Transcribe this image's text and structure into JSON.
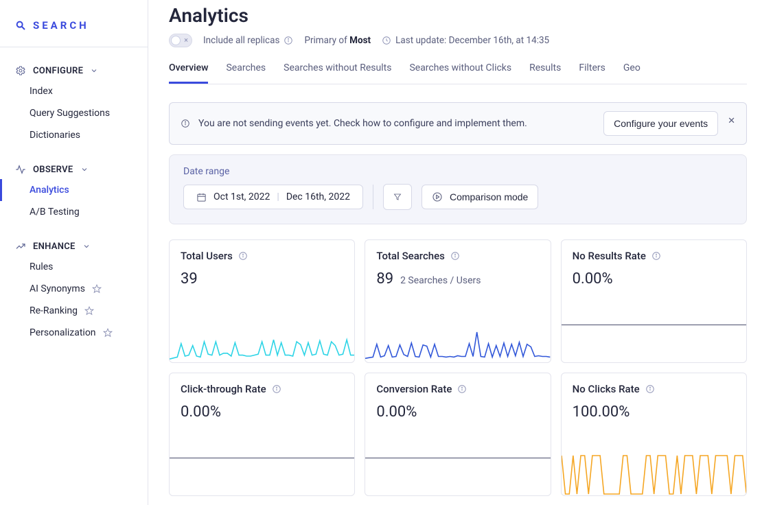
{
  "brand": {
    "label": "SEARCH"
  },
  "sidebar": {
    "configure": {
      "label": "CONFIGURE",
      "items": [
        {
          "label": "Index"
        },
        {
          "label": "Query Suggestions"
        },
        {
          "label": "Dictionaries"
        }
      ]
    },
    "observe": {
      "label": "OBSERVE",
      "items": [
        {
          "label": "Analytics"
        },
        {
          "label": "A/B Testing"
        }
      ]
    },
    "enhance": {
      "label": "ENHANCE",
      "items": [
        {
          "label": "Rules"
        },
        {
          "label": "AI Synonyms"
        },
        {
          "label": "Re-Ranking"
        },
        {
          "label": "Personalization"
        }
      ]
    }
  },
  "header": {
    "title": "Analytics",
    "includeReplicas": "Include all replicas",
    "primaryPrefix": "Primary of ",
    "primaryIndex": "Most",
    "lastUpdate": "Last update: December 16th, at 14:35"
  },
  "tabs": [
    "Overview",
    "Searches",
    "Searches without Results",
    "Searches without Clicks",
    "Results",
    "Filters",
    "Geo"
  ],
  "banner": {
    "message": "You are not sending events yet. Check how to configure and implement them.",
    "cta": "Configure your events"
  },
  "filters": {
    "label": "Date range",
    "from": "Oct 1st, 2022",
    "to": "Dec 16th, 2022",
    "comparison": "Comparison mode"
  },
  "cards": {
    "totalUsers": {
      "title": "Total Users",
      "value": "39"
    },
    "totalSearches": {
      "title": "Total Searches",
      "value": "89",
      "sub": "2 Searches / Users"
    },
    "noResultsRate": {
      "title": "No Results Rate",
      "value": "0.00%"
    },
    "ctr": {
      "title": "Click-through Rate",
      "value": "0.00%"
    },
    "conversion": {
      "title": "Conversion Rate",
      "value": "0.00%"
    },
    "noClicksRate": {
      "title": "No Clicks Rate",
      "value": "100.00%"
    }
  },
  "chart_data": [
    {
      "type": "line",
      "title": "Total Users",
      "ylim": [
        0,
        4
      ],
      "values": [
        0.2,
        0.3,
        0.4,
        1.8,
        0.5,
        0.6,
        1.6,
        0.5,
        0.4,
        2.0,
        0.7,
        0.6,
        2.0,
        0.6,
        0.8,
        0.8,
        0.5,
        1.9,
        0.6,
        0.6,
        0.5,
        0.5,
        0.6,
        0.7,
        2.0,
        0.6,
        0.6,
        2.2,
        0.6,
        1.9,
        0.6,
        0.6,
        0.5,
        2.0,
        1.7,
        0.6,
        1.9,
        0.6,
        0.7,
        2.1,
        0.7,
        0.6,
        2.0,
        1.6,
        0.6,
        0.7,
        2.2,
        0.6,
        0.6
      ],
      "color": "#2dd4e6"
    },
    {
      "type": "line",
      "title": "Total Searches",
      "ylim": [
        0,
        6
      ],
      "values": [
        0.4,
        0.5,
        0.6,
        2.6,
        0.6,
        0.8,
        2.4,
        0.6,
        0.7,
        2.5,
        1.0,
        0.7,
        2.8,
        0.7,
        0.6,
        2.5,
        2.3,
        0.6,
        2.6,
        0.7,
        0.7,
        0.6,
        0.7,
        0.6,
        0.8,
        0.7,
        0.7,
        2.7,
        0.7,
        4.5,
        0.7,
        0.6,
        2.7,
        0.6,
        2.4,
        0.7,
        2.8,
        0.7,
        2.6,
        0.8,
        2.9,
        0.7,
        2.6,
        2.2,
        0.7,
        0.8,
        0.7,
        0.7,
        0.6
      ],
      "color": "#3157d9"
    },
    {
      "type": "line",
      "title": "No Results Rate",
      "ylim": [
        0,
        1
      ],
      "values": [],
      "color": "#484b6a"
    },
    {
      "type": "line",
      "title": "Click-through Rate",
      "ylim": [
        0,
        1
      ],
      "values": [],
      "color": "#484b6a"
    },
    {
      "type": "line",
      "title": "Conversion Rate",
      "ylim": [
        0,
        1
      ],
      "values": [],
      "color": "#484b6a"
    },
    {
      "type": "line",
      "title": "No Clicks Rate",
      "ylim": [
        0,
        1
      ],
      "values": [
        1,
        0,
        0,
        1,
        0,
        1,
        1,
        0,
        1,
        1,
        1,
        0,
        0,
        0,
        0,
        0,
        1,
        1,
        0,
        0,
        0,
        0,
        1,
        1,
        0,
        1,
        1,
        1,
        0,
        0,
        1,
        0,
        1,
        1,
        1,
        0,
        1,
        1,
        1,
        0,
        1,
        1,
        1,
        1,
        0,
        1,
        1,
        1,
        0
      ],
      "color": "#f5a623"
    }
  ]
}
